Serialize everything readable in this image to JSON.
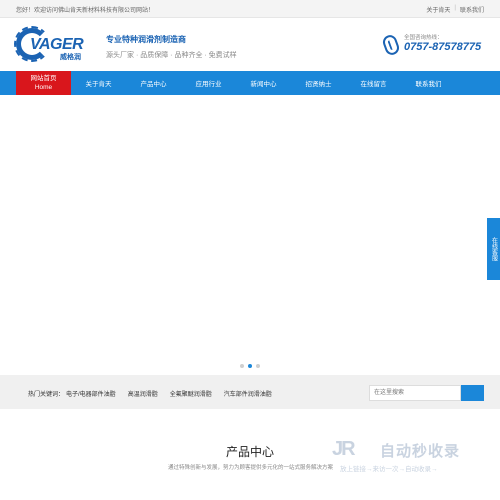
{
  "topbar": {
    "welcome": "您好！欢迎访问佛山肯天新材料科技有限公司网站！",
    "links": [
      "关于肯天",
      "联系我们"
    ]
  },
  "header": {
    "logo_word": "VAGER",
    "logo_cn": "威格润",
    "slogan_main": "专业特种润滑剂制造商",
    "slogan_sub": "源头厂家 · 品质保障 · 品种齐全 · 免费试样",
    "hotline_label": "全国咨询热线：",
    "hotline_number": "0757-87578775"
  },
  "nav": {
    "items": [
      {
        "label": "网站首页",
        "sub": "Home"
      },
      {
        "label": "关于肯天"
      },
      {
        "label": "产品中心"
      },
      {
        "label": "应用行业"
      },
      {
        "label": "新闻中心"
      },
      {
        "label": "招贤纳士"
      },
      {
        "label": "在线留言"
      },
      {
        "label": "联系我们"
      }
    ],
    "active_index": 0
  },
  "banner": {
    "active_slide": 1,
    "slide_count": 3
  },
  "sidetab": {
    "label": "在线客服"
  },
  "keywords": {
    "head": "热门关键词：",
    "items": [
      "电子/电器部件油脂",
      "高温润滑脂",
      "全氟聚醚润滑脂",
      "汽车部件润滑油脂"
    ]
  },
  "search": {
    "placeholder": "在这里搜索"
  },
  "products": {
    "title": "产品中心",
    "subtitle": "通过特殊创新与发展，努力为顾客提供多元化的一站式服务解决方案"
  },
  "watermark": {
    "mark": "JR",
    "name": "自动秒收录",
    "tag": "放上链接→来访一次→自动收录→"
  },
  "colors": {
    "brand": "#1b63b3",
    "nav": "#1b87d9",
    "active": "#d9161c"
  }
}
